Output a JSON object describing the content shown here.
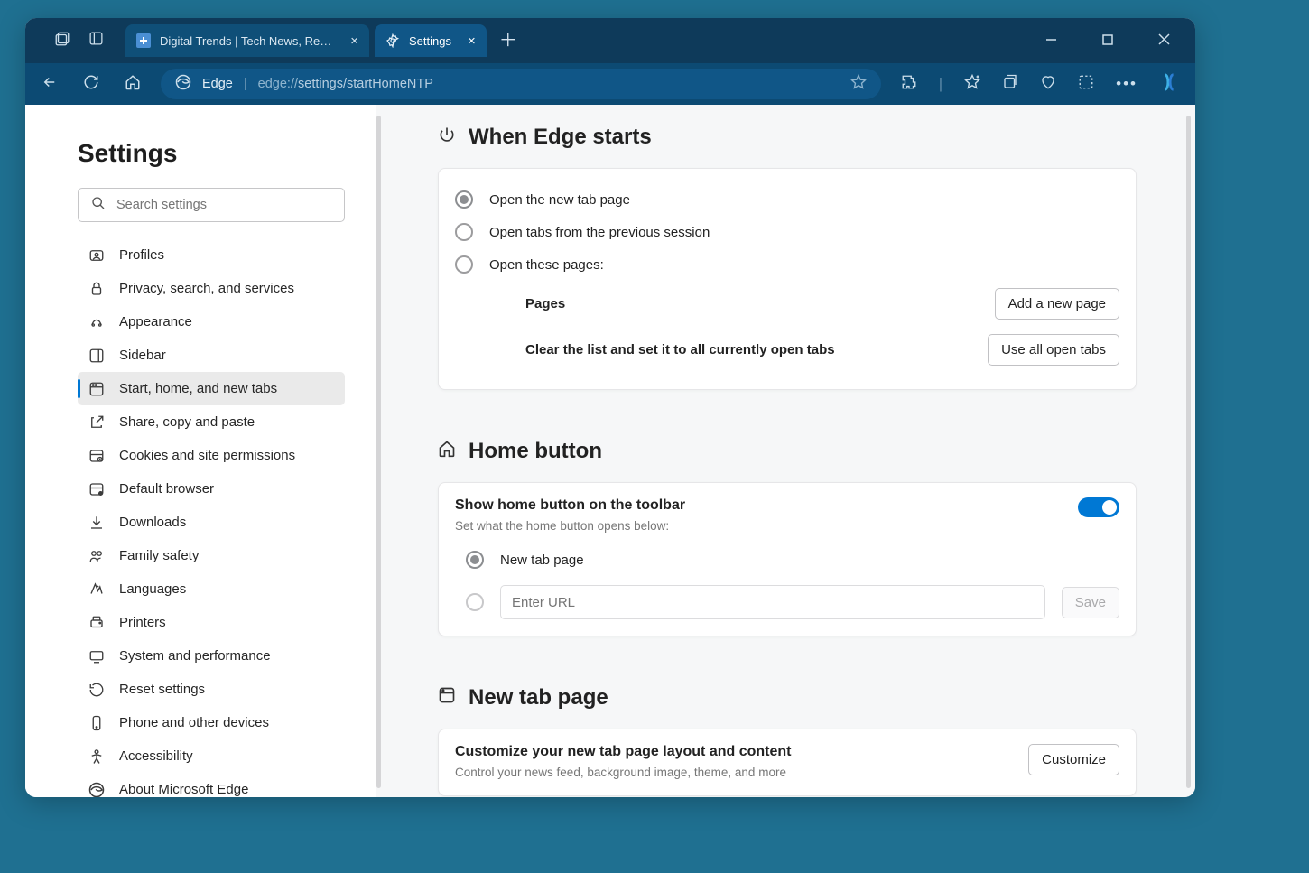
{
  "titlebar": {
    "tab1_title": "Digital Trends | Tech News, Revie",
    "tab2_title": "Settings"
  },
  "toolbar": {
    "edge_label": "Edge",
    "url_scheme": "edge://",
    "url_path": "settings/startHomeNTP"
  },
  "sidebar": {
    "title": "Settings",
    "search_placeholder": "Search settings",
    "items": [
      {
        "label": "Profiles"
      },
      {
        "label": "Privacy, search, and services"
      },
      {
        "label": "Appearance"
      },
      {
        "label": "Sidebar"
      },
      {
        "label": "Start, home, and new tabs"
      },
      {
        "label": "Share, copy and paste"
      },
      {
        "label": "Cookies and site permissions"
      },
      {
        "label": "Default browser"
      },
      {
        "label": "Downloads"
      },
      {
        "label": "Family safety"
      },
      {
        "label": "Languages"
      },
      {
        "label": "Printers"
      },
      {
        "label": "System and performance"
      },
      {
        "label": "Reset settings"
      },
      {
        "label": "Phone and other devices"
      },
      {
        "label": "Accessibility"
      },
      {
        "label": "About Microsoft Edge"
      }
    ]
  },
  "sections": {
    "when_starts": {
      "title": "When Edge starts",
      "opt1": "Open the new tab page",
      "opt2": "Open tabs from the previous session",
      "opt3": "Open these pages:",
      "pages_label": "Pages",
      "add_btn": "Add a new page",
      "clear_label": "Clear the list and set it to all currently open tabs",
      "use_all_btn": "Use all open tabs"
    },
    "home_button": {
      "title": "Home button",
      "row_label": "Show home button on the toolbar",
      "row_sub": "Set what the home button opens below:",
      "opt_newtab": "New tab page",
      "url_placeholder": "Enter URL",
      "save_btn": "Save"
    },
    "new_tab": {
      "title": "New tab page",
      "row_label": "Customize your new tab page layout and content",
      "row_sub": "Control your news feed, background image, theme, and more",
      "customize_btn": "Customize"
    }
  }
}
